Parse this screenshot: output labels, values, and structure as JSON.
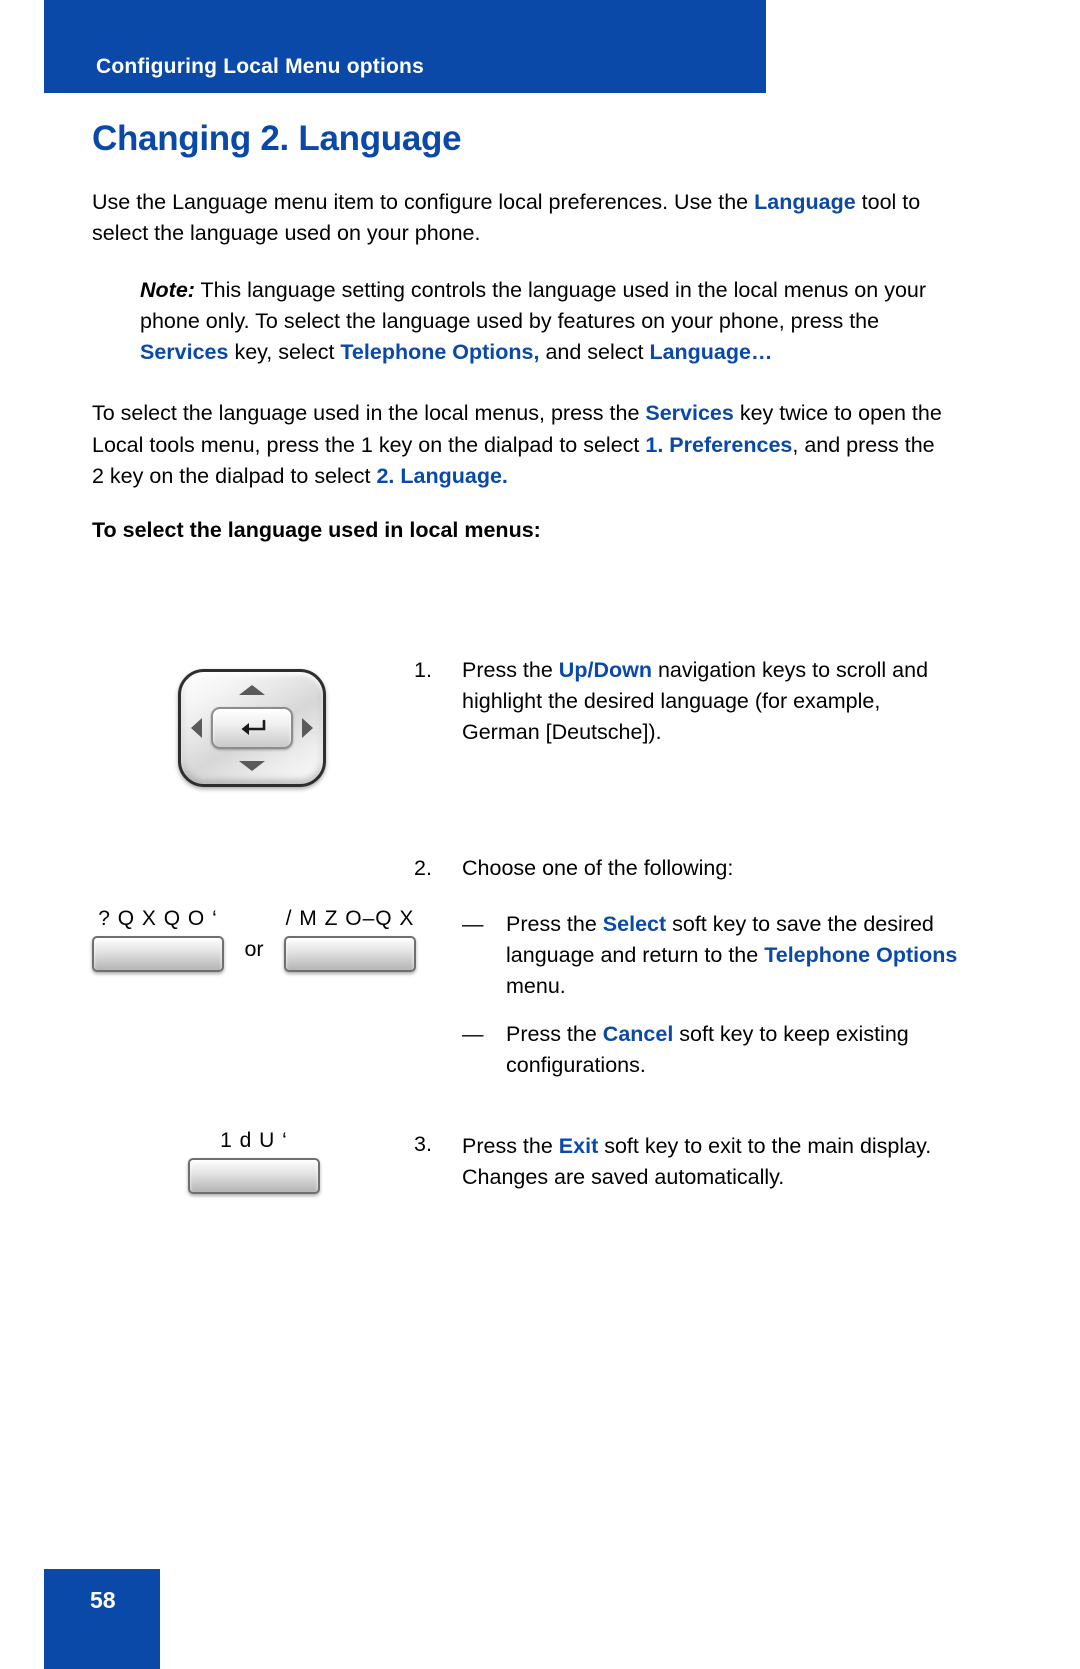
{
  "colors": {
    "brand_blue": "#0B49A8",
    "text_black": "#000000",
    "page_white": "#FFFFFF"
  },
  "header": {
    "running_title": "Configuring Local Menu options"
  },
  "page": {
    "title": "Changing 2. Language",
    "number": "58"
  },
  "intro": {
    "part1": "Use the Language menu item to configure local preferences. Use the ",
    "highlight1": "Language",
    "part2": " tool to select the language used on your phone."
  },
  "note": {
    "label": "Note:",
    "part1": " This language setting controls the language used in the local menus on your phone only. To select the language used by features on your phone, press the ",
    "highlight1": "Services",
    "part2": " key, select ",
    "highlight2": "Telephone Options,",
    "part3": " and select ",
    "highlight3": "Language…"
  },
  "instructions": {
    "part1": "To select the language used in the local menus, press the ",
    "highlight1": "Services",
    "part2": " key twice to open the Local tools menu, press the 1 key on the dialpad to select ",
    "highlight2": "1. Preferences",
    "part3": ", and press the 2 key on the dialpad to select ",
    "highlight3": "2. Language."
  },
  "subheading": "To select the language used in local menus:",
  "steps": [
    {
      "number": "1.",
      "text_part1": "Press the ",
      "highlight1": "Up",
      "separator": "/",
      "highlight2": "Down",
      "text_part2": " navigation keys to scroll and highlight the desired language (for example, German [Deutsche])."
    },
    {
      "number": "2.",
      "text_part1": "Choose one of the following:"
    },
    {
      "number": "3.",
      "text_part1": "Press the ",
      "highlight1": "Exit",
      "text_part2": " soft key to exit to the main display. Changes are saved automatically."
    }
  ],
  "step2_bullets": [
    {
      "dash": "—",
      "text_part1": "Press the ",
      "highlight1": "Select",
      "text_part2": " soft key to save the desired language and return to the ",
      "highlight2": "Telephone Options",
      "text_part3": " menu."
    },
    {
      "dash": "—",
      "text_part1": "Press the ",
      "highlight1": "Cancel",
      "text_part2": " soft key to keep existing configurations."
    }
  ],
  "artwork": {
    "navpad_name": "navigation-keys-cluster",
    "softkey_1_glyph": "? Q X Q O ‘",
    "softkey_2_glyph": "/ M Z O–Q X",
    "softkey_3_glyph": "1 d U ‘",
    "or_label": "or",
    "icons": {
      "up": "triangle-up-icon",
      "down": "triangle-down-icon",
      "left": "triangle-left-icon",
      "right": "triangle-right-icon",
      "center": "enter-return-icon"
    }
  }
}
